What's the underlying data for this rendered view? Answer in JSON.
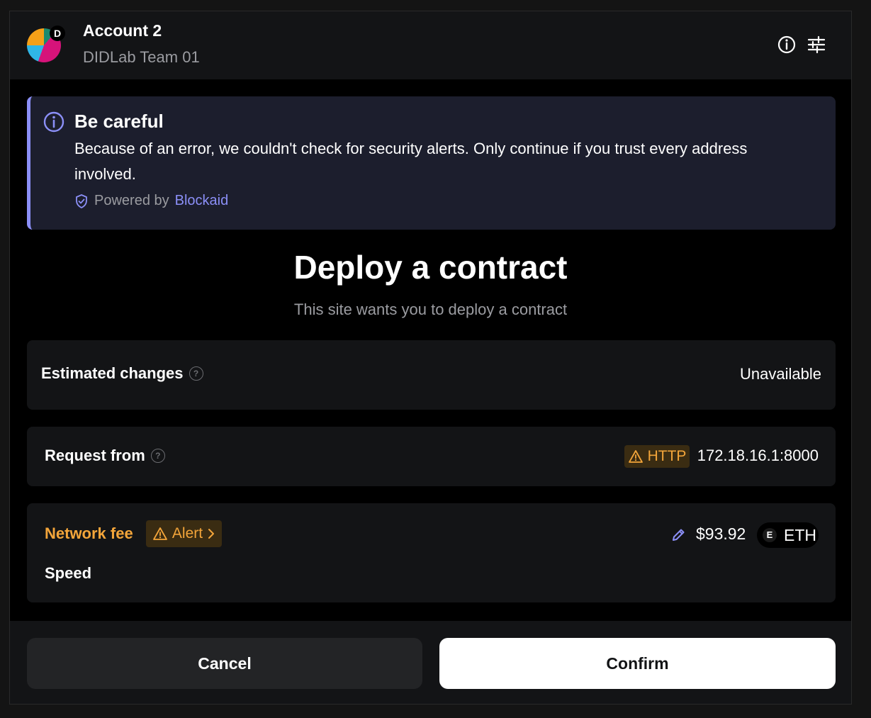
{
  "header": {
    "account_name": "Account 2",
    "account_sub": "DIDLab Team 01",
    "avatar_letter": "D",
    "icons": [
      "info-icon",
      "settings-sliders-icon"
    ]
  },
  "alert": {
    "title": "Be careful",
    "body": "Because of an error, we couldn't check for security alerts. Only continue if you trust every address involved.",
    "powered_prefix": "Powered by",
    "powered_link": "Blockaid",
    "accent_color": "#8b8ff7"
  },
  "main": {
    "title": "Deploy a contract",
    "subtitle": "This site wants you to deploy a contract"
  },
  "estimated_changes": {
    "label": "Estimated changes",
    "value": "Unavailable"
  },
  "request_from": {
    "label": "Request from",
    "badge": "HTTP",
    "value": "172.18.16.1:8000"
  },
  "network_fee": {
    "label": "Network fee",
    "alert_chip": "Alert",
    "amount": "$93.92",
    "token_letter": "E",
    "token": "ETH",
    "speed_label": "Speed",
    "warning_color": "#f3a53a"
  },
  "footer": {
    "cancel_label": "Cancel",
    "confirm_label": "Confirm"
  }
}
